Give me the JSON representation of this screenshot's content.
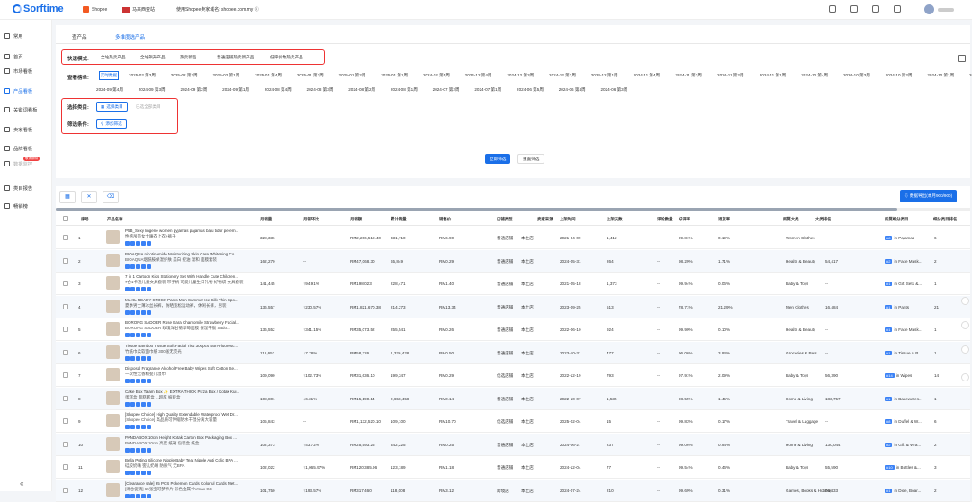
{
  "app": {
    "brand": "Sorftime"
  },
  "topbar": {
    "platform": "Shopee",
    "site": "马来西亚站",
    "domain": "使用Shopee卖家域名: shopee.com.my ⓘ"
  },
  "sidebar": {
    "items": [
      {
        "label": "常用",
        "icon": "star-icon"
      },
      {
        "label": "首页",
        "icon": "home-icon"
      },
      {
        "label": "市场看板",
        "icon": "market-icon"
      },
      {
        "label": "产品看板",
        "icon": "product-icon",
        "active": true
      },
      {
        "label": "关键词看板",
        "icon": "keyword-icon"
      },
      {
        "label": "卖家看板",
        "icon": "seller-icon"
      },
      {
        "label": "品牌看板",
        "icon": "brand-icon"
      },
      {
        "label": "数据监控",
        "icon": "monitor-icon",
        "badge": "敬请期待",
        "disabled": true
      },
      {
        "label": "类目报告",
        "icon": "report-icon"
      },
      {
        "label": "畅销榜",
        "icon": "bestseller-icon"
      }
    ],
    "collapse": "«"
  },
  "tabs": [
    "查产品",
    "多维度选产品"
  ],
  "quick": {
    "label": "快速模式:",
    "chips": [
      "全站热卖产品",
      "全站飙升产品",
      "热卖新品",
      "普通店铺热卖新产品",
      "低评价数热卖产品"
    ]
  },
  "week": {
    "label": "查看榜单:",
    "chips": [
      "实时数据",
      "2025-02 第3周",
      "2025-02 第2周",
      "2025-02 第1周",
      "2025-01 第4周",
      "2025-01 第3周",
      "2025-01 第2周",
      "2025-01 第1周",
      "2024-12 第5周",
      "2024-12 第4周",
      "2024-12 第3周",
      "2024-12 第2周",
      "2024-12 第1周",
      "2024-11 第4周",
      "2024-11 第3周",
      "2024-11 第2周",
      "2024-11 第1周",
      "2024-10 第4周",
      "2024-10 第3周",
      "2024-10 第2周",
      "2024-10 第1周",
      "2024-09 第5周",
      "2024-09 第4周",
      "2024-09 第3周",
      "2024-09 第2周",
      "2024-09 第1周",
      "2024-08 第4周",
      "2024-08 第3周",
      "2024-08 第2周",
      "2024-08 第1周",
      "2024-07 第2周",
      "2024-07 第1周",
      "2024-06 第5周",
      "2024-06 第4周",
      "2024-06 第3周"
    ]
  },
  "filter": {
    "category_label": "选择类目:",
    "category_btn": "选择类目",
    "category_hint": "已选全部类目",
    "cond_label": "筛选条件:",
    "cond_btn": "添加筛选"
  },
  "actions": {
    "search": "立即筛选",
    "reset": "重置筛选"
  },
  "table": {
    "export": "数据导出(本月900/900)",
    "headers": [
      "序号",
      "产品名称",
      "月销量",
      "月销环比",
      "月销额",
      "累计销量",
      "销售价",
      "店铺类型",
      "卖家来源",
      "上架时间",
      "上架天数",
      "评论数量",
      "好评率",
      "退货率",
      "所属大类",
      "大类排名",
      "所属细分类目",
      "细分类目排名"
    ],
    "rows": [
      {
        "n": "1",
        "name1": "P5B_Sexy lingerie women pyjamas pajamas baju tidur perem...",
        "name2": "性感吊带女士睡衣上衣+裤子",
        "sales": "328,336",
        "growth": "--",
        "revenue": "RM2,266,518.40",
        "total": "331,710",
        "price": "RM6.90",
        "store": "普通店铺",
        "origin": "本土店",
        "date": "2021-04-09",
        "days": "1,412",
        "reviews": "--",
        "good": "99.81%",
        "ret": "0.19%",
        "cat": "Women Clothes",
        "rank": "--",
        "sub": "in Pajamas",
        "subrank": "#8",
        "subr": "6"
      },
      {
        "n": "2",
        "name1": "BIOAQUA nicotinamide Moisturizing Skin Care Whitening Co...",
        "name2": "BIOAQUA烟酰胺保湿护肤 美白 控油 温和 面膜套装",
        "sales": "162,270",
        "growth": "--",
        "revenue": "RM47,068.30",
        "total": "65,849",
        "price": "RM0.29",
        "store": "普通店铺",
        "origin": "本土店",
        "date": "2024-05-31",
        "days": "264",
        "reviews": "--",
        "good": "98.29%",
        "ret": "1.71%",
        "cat": "Health & Beauty",
        "rank": "54,417",
        "sub": "in Face Mask...",
        "subrank": "#2",
        "subr": "2"
      },
      {
        "n": "3",
        "name1": "7 in 1 Cartoon Kids Stationery Set With Handle Cute Children...",
        "name2": "7合1卡通儿童文具套装 带手柄 可爱儿童生日礼物 好物袋 文具套装",
        "sales": "141,445",
        "growth": "↑94.91%",
        "revenue": "RM198,023",
        "total": "228,471",
        "price": "RM1.40",
        "store": "普通店铺",
        "origin": "本土店",
        "date": "2021-05-18",
        "days": "1,373",
        "reviews": "--",
        "good": "99.94%",
        "ret": "0.06%",
        "cat": "Baby & Toys",
        "rank": "--",
        "sub": "in Gift Sets &...",
        "subrank": "#1",
        "subr": "1"
      },
      {
        "n": "4",
        "name1": "MJ.XL READY STOCK Pants Men Summer Ice Silk Thin Spo...",
        "name2": "夏季男士薄冰丝长裤，防晒宽松运动裤，休闲长裤，男装",
        "sales": "136,557",
        "growth": "↑230.57%",
        "revenue": "RM1,821,670.38",
        "total": "214,273",
        "price": "RM13.34",
        "store": "普通店铺",
        "origin": "本土店",
        "date": "2023-09-25",
        "days": "513",
        "reviews": "--",
        "good": "78.71%",
        "ret": "21.29%",
        "cat": "Men Clothes",
        "rank": "16,484",
        "sub": "in Pants",
        "subrank": "#1",
        "subr": "21"
      },
      {
        "n": "5",
        "name1": "BORONG SADOER Rose Bara Chamomile Strawberry Facial...",
        "name2": "BORONG SADOER 玫瑰洋甘菊草莓面膜 保湿平衡 Sado...",
        "sales": "136,552",
        "growth": "↑341.15%",
        "revenue": "RM35,073.52",
        "total": "255,541",
        "price": "RM0.26",
        "store": "普通店铺",
        "origin": "本土店",
        "date": "2022-06-10",
        "days": "924",
        "reviews": "--",
        "good": "99.90%",
        "ret": "0.10%",
        "cat": "Health & Beauty",
        "rank": "--",
        "sub": "in Face Mask...",
        "subrank": "#1",
        "subr": "1"
      },
      {
        "n": "6",
        "name1": "Tissue Bamboo Tissue Soft Facial Tisu 300pcs Non-Fluoresc...",
        "name2": "竹纸巾柔软面巾纸 300张无荧光",
        "sales": "116,652",
        "growth": "↓7.78%",
        "revenue": "RM58,326",
        "total": "1,326,428",
        "price": "RM0.50",
        "store": "普通店铺",
        "origin": "本土店",
        "date": "2023-10-31",
        "days": "477",
        "reviews": "--",
        "good": "96.06%",
        "ret": "3.94%",
        "cat": "Groceries & Pets",
        "rank": "--",
        "sub": "in Tissue & P...",
        "subrank": "#1",
        "subr": "1"
      },
      {
        "n": "7",
        "name1": "Disposal Fragrance Alcohol Free Baby Wipes Soft Cotton Se...",
        "name2": "一次性无香精婴儿湿巾",
        "sales": "109,090",
        "growth": "↑102.73%",
        "revenue": "RM31,636.10",
        "total": "199,347",
        "price": "RM0.29",
        "store": "优选店铺",
        "origin": "本土店",
        "date": "2022-12-19",
        "days": "793",
        "reviews": "--",
        "good": "97.91%",
        "ret": "2.09%",
        "cat": "Baby & Toys",
        "rank": "56,390",
        "sub": "in Wipes",
        "subrank": "#14",
        "subr": "14"
      },
      {
        "n": "8",
        "name1": "Cake Box Taiam Box ✨ EXTRA THICK Pizza Box / Kotak Kui...",
        "name2": "蛋糕盒 面糕糕盒 ...超厚 披萨盒",
        "sales": "108,801",
        "growth": "↓6.31%",
        "revenue": "RM15,190.14",
        "total": "2,658,458",
        "price": "RM0.14",
        "store": "普通店铺",
        "origin": "本土店",
        "date": "2022-10-07",
        "days": "1,535",
        "reviews": "--",
        "good": "98.55%",
        "ret": "1.45%",
        "cat": "Home & Living",
        "rank": "183,757",
        "sub": "in Bakewares...",
        "subrank": "#1",
        "subr": "1"
      },
      {
        "n": "9",
        "name1": "[Shopee Choice] High Quality Extendable Waterproof Wet Dr...",
        "name2": "[Shopee Choice] 高品质可伸缩防水干湿分离大容量",
        "sales": "105,843",
        "growth": "--",
        "revenue": "RM1,132,520.10",
        "total": "109,100",
        "price": "RM10.70",
        "store": "优选店铺",
        "origin": "本土店",
        "date": "2025-02-04",
        "days": "15",
        "reviews": "--",
        "good": "99.83%",
        "ret": "0.17%",
        "cat": "Travel & Luggage",
        "rank": "--",
        "sub": "in Duffel & W...",
        "subrank": "#8",
        "subr": "6"
      },
      {
        "n": "10",
        "name1": "PANDABOX 10cm Height Kotak Carton Box Packaging Box ...",
        "name2": "PANDABOX 10cm 高度 纸箱 包装盒 纸盒",
        "sales": "102,373",
        "growth": "↑43.72%",
        "revenue": "RM25,593.25",
        "total": "342,225",
        "price": "RM0.25",
        "store": "普通店铺",
        "origin": "本土店",
        "date": "2024-06-27",
        "days": "237",
        "reviews": "--",
        "good": "99.06%",
        "ret": "0.94%",
        "cat": "Home & Living",
        "rank": "130,044",
        "sub": "in Gift & Wra...",
        "subrank": "#2",
        "subr": "2"
      },
      {
        "n": "11",
        "name1": "Bella Puting Silicone Nipple Baby Teat Nipple Anti Colic BPA ...",
        "name2": "硅胶奶嘴 婴儿奶嘴 防胀气 无BPA",
        "sales": "102,022",
        "growth": "↑1,065.97%",
        "revenue": "RM120,385.96",
        "total": "123,189",
        "price": "RM1.18",
        "store": "普通店铺",
        "origin": "本土店",
        "date": "2024-12-04",
        "days": "77",
        "reviews": "--",
        "good": "99.54%",
        "ret": "0.46%",
        "cat": "Baby & Toys",
        "rank": "55,590",
        "sub": "in Bottles &...",
        "subrank": "#10",
        "subr": "3"
      },
      {
        "n": "12",
        "name1": "[Clearance sale] 65 PCS Pokemon Cards Colorful Cards Met...",
        "name2": "[清仓促销] 65张宝可梦卡片 彩色金属卡Vmax GX",
        "sales": "101,750",
        "growth": "↑193.57%",
        "revenue": "RM317,460",
        "total": "118,008",
        "price": "RM3.12",
        "store": "跨境店",
        "origin": "本土店",
        "date": "2024-07-24",
        "days": "210",
        "reviews": "--",
        "good": "99.69%",
        "ret": "0.31%",
        "cat": "Games, Books & Hobbies",
        "rank": "86,333",
        "sub": "in Dice, Boar...",
        "subrank": "#1",
        "subr": "2"
      }
    ]
  },
  "colors": {
    "accent": "#1a6fe8",
    "highlight": "#e33333",
    "badge": "#3b82f6"
  }
}
